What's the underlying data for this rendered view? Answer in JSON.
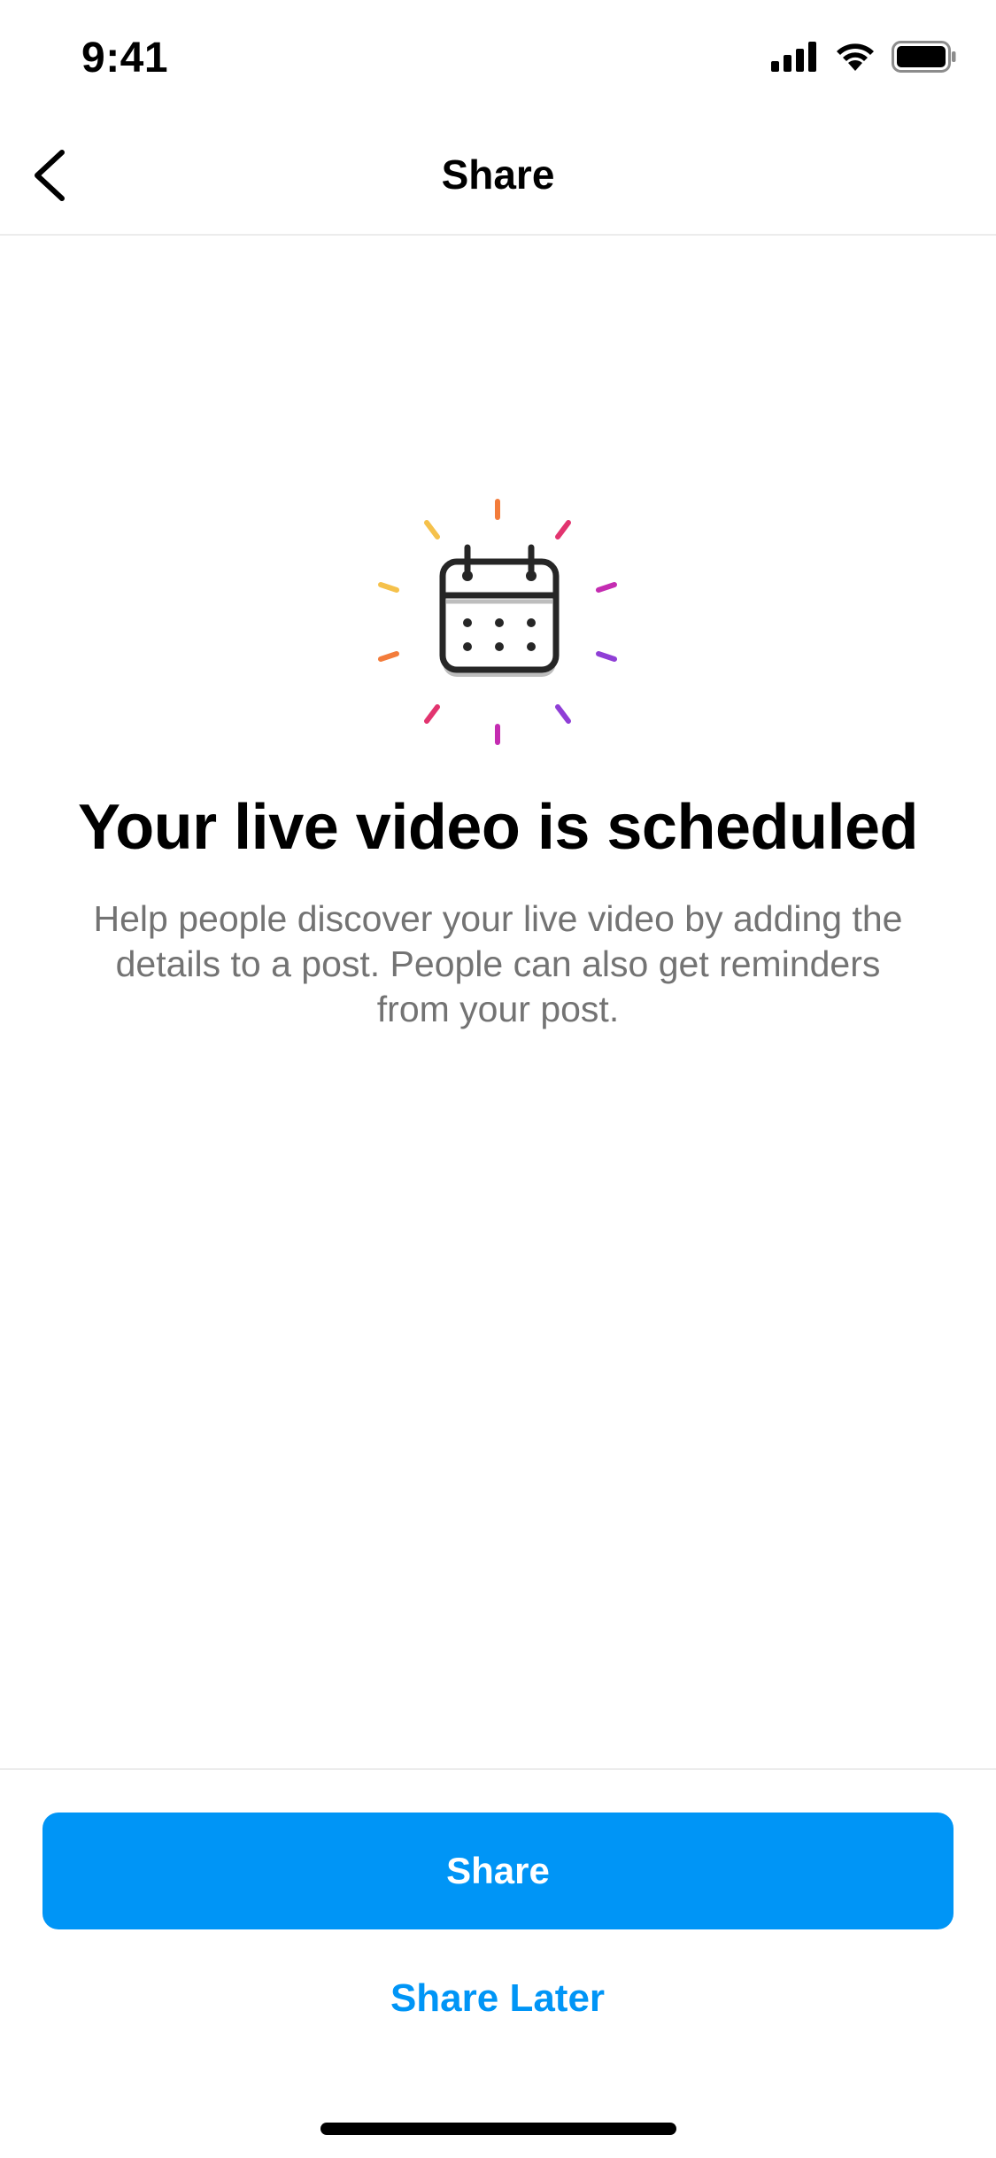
{
  "status_bar": {
    "time": "9:41",
    "icons": [
      "cellular-signal-icon",
      "wifi-icon",
      "battery-icon"
    ]
  },
  "nav": {
    "back_icon": "chevron-left-icon",
    "title": "Share"
  },
  "content": {
    "icon": "calendar-icon",
    "headline": "Your live video is scheduled",
    "description": "Help people discover your live video by adding the details to a post. People can also get reminders from your post."
  },
  "actions": {
    "primary_label": "Share",
    "secondary_label": "Share Later"
  },
  "colors": {
    "primary_blue": "#0095f6",
    "text_secondary": "#737373",
    "divider": "#ececec",
    "ray_orange": "#f37c3b",
    "ray_yellow": "#f5c14b",
    "ray_pink": "#e2346f",
    "ray_magenta": "#c42cb1",
    "ray_purple": "#8f3fd6"
  }
}
